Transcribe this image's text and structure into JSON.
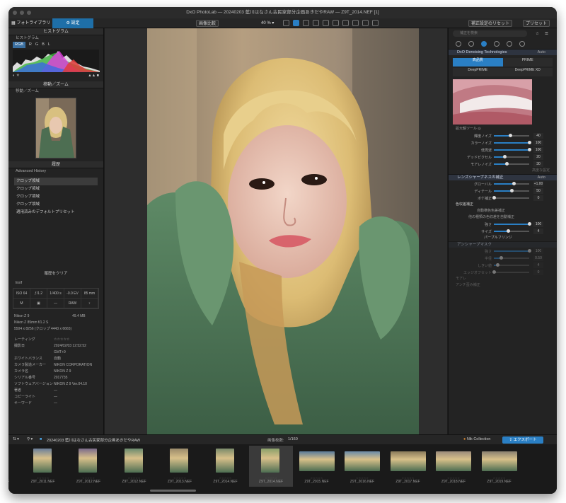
{
  "window": {
    "title": "DxO PhotoLab — 20240203 藍川はなさん古民家部分企画あきだやRAW — Z9T_2014.NEF [1]"
  },
  "toolbar": {
    "tab_photolibrary": "フォトライブラリ",
    "tab_settings": "設定",
    "compare": "画像比較",
    "zoom": "40 %",
    "reset": "補正設定のリセット",
    "presets": "プリセット"
  },
  "left_panel": {
    "histogram_title": "ヒストグラム",
    "histogram_sub": "ヒストグラム",
    "channels": [
      "RGB",
      "R",
      "G",
      "B",
      "L"
    ],
    "move_zoom_title": "移動／ズーム",
    "move_zoom_sub": "移動／ズーム",
    "history_title": "履歴",
    "history_sub": "Advanced History",
    "history_items": [
      "クロップ領域",
      "クロップ領域",
      "クロップ領域",
      "クロップ領域",
      "適用済みのデフォルトプリセット"
    ],
    "clear_history": "履歴をクリア",
    "exif_title": "Exif",
    "exif_cells": [
      "ISO 64",
      "ƒ/1.2",
      "1/400 s",
      "-0.0 EV",
      "85 mm",
      "M",
      "",
      "—",
      "RAW",
      ""
    ],
    "camera": "Nikon Z 9",
    "size": "49.4 MB",
    "lens": "Nikon Z 85mm f/1.2 S",
    "dimensions": "5504 x 8256 (クロップ 4443 x 6665)",
    "meta": [
      {
        "k": "レーティング",
        "v": "☆☆☆☆☆"
      },
      {
        "k": "撮影日",
        "v": "2024/02/03 12:52:52"
      },
      {
        "k": "",
        "v": "GMT+9"
      },
      {
        "k": "ホワイトバランス",
        "v": "自動"
      },
      {
        "k": "カメラ製造メーカー",
        "v": "NIKON CORPORATION"
      },
      {
        "k": "カメラ名",
        "v": "NIKON Z 9"
      },
      {
        "k": "シリアル番号",
        "v": "2017735"
      },
      {
        "k": "ソフトウェアバージョン",
        "v": "NIKON Z 9 Ver.04.10"
      },
      {
        "k": "著者",
        "v": "—"
      },
      {
        "k": "コピーライト",
        "v": "—"
      },
      {
        "k": "キーワード",
        "v": "—"
      }
    ]
  },
  "right_panel": {
    "search_placeholder": "補正を検索",
    "denoise_title": "DxO Denoising Technologies",
    "denoise_auto": "Auto",
    "tabs": [
      "高品質",
      "PRIME",
      "DeepPRIME",
      "DeepPRIME XD"
    ],
    "zoom_tool": "拡大鏡ツール",
    "sliders": [
      {
        "label": "輝度ノイズ",
        "value": "40",
        "pct": 45
      },
      {
        "label": "カラーノイズ",
        "value": "100",
        "pct": 100
      },
      {
        "label": "低周波",
        "value": "100",
        "pct": 100
      },
      {
        "label": "デッドピクセル",
        "value": "20",
        "pct": 30
      },
      {
        "label": "モアレノイズ",
        "value": "30",
        "pct": 35
      }
    ],
    "restore_default": "高度な設定",
    "lens_title": "レンズシャープネスの補正",
    "lens_auto": "Auto",
    "lens_sliders": [
      {
        "label": "グローバル",
        "value": "+1.00",
        "pct": 55
      },
      {
        "label": "ディテール",
        "value": "50",
        "pct": 50
      },
      {
        "label": "ボケ補正",
        "value": "0",
        "pct": 0
      }
    ],
    "chroma_title": "色収差補正",
    "chroma_auto": "自動横色色差補正",
    "chroma_sub": "他の種類の色収差を自動補正",
    "chroma_sliders": [
      {
        "label": "強さ",
        "value": "100",
        "pct": 100
      },
      {
        "label": "サイズ",
        "value": "4",
        "pct": 40
      }
    ],
    "purple": "パープルフリンジ",
    "unsharp_title": "アンシャープマスク",
    "unsharp_sliders": [
      {
        "label": "強さ",
        "value": "100",
        "pct": 100
      },
      {
        "label": "半径",
        "value": "0.50",
        "pct": 20
      },
      {
        "label": "しきい値",
        "value": "4",
        "pct": 10
      },
      {
        "label": "エッジオフセット",
        "value": "0",
        "pct": 0
      }
    ],
    "moire_title": "モアレ",
    "moire_value": "0",
    "hdr_title": "アンチ歪み補正"
  },
  "bottom": {
    "path": "20240203 藍川はなさん古民家部分企画あきだやRAW",
    "count_label": "画像枚数:",
    "count": "1/160",
    "nik": "Nik Collection",
    "export": "エクスポート",
    "films": [
      "Z9T_2010.NEF",
      "Z9T_2011.NEF",
      "Z9T_2012.NEF",
      "Z9T_2012.NEF",
      "Z9T_2013.NEF",
      "Z9T_2014.NEF",
      "Z9T_2014.NEF",
      "Z9T_2015.NEF",
      "Z9T_2016.NEF",
      "Z9T_2017.NEF",
      "Z9T_2018.NEF",
      "Z9T_2019.NEF"
    ]
  },
  "colors": {
    "accent": "#2a7fc4",
    "bg": "#1c1c1c",
    "panel": "#232323"
  }
}
